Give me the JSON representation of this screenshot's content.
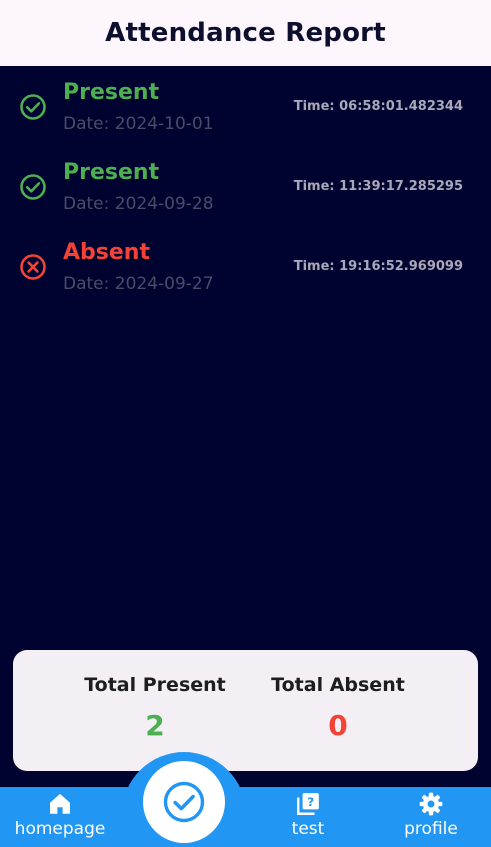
{
  "appbar": {
    "title": "Attendance Report"
  },
  "records": [
    {
      "status": "Present",
      "date": "Date: 2024-10-01",
      "time": "Time: 06:58:01.482344",
      "icon": "check-circle-icon",
      "color": "#4CAF50"
    },
    {
      "status": "Present",
      "date": "Date: 2024-09-28",
      "time": "Time: 11:39:17.285295",
      "icon": "check-circle-icon",
      "color": "#4CAF50"
    },
    {
      "status": "Absent",
      "date": "Date: 2024-09-27",
      "time": "Time: 19:16:52.969099",
      "icon": "cancel-circle-icon",
      "color": "#F44336"
    }
  ],
  "summary": {
    "present_label": "Total Present",
    "present_value": "2",
    "absent_label": "Total Absent",
    "absent_value": "0"
  },
  "nav": {
    "items": [
      {
        "label": "homepage",
        "icon": "home-icon"
      },
      {
        "label": "test",
        "icon": "quiz-icon"
      },
      {
        "label": "profile",
        "icon": "gear-icon"
      }
    ],
    "fab_icon": "check-circle-icon"
  },
  "colors": {
    "background": "#000230",
    "appbar": "#FDF6FD",
    "accent": "#2196F3",
    "present": "#4CAF50",
    "absent": "#F44336"
  }
}
